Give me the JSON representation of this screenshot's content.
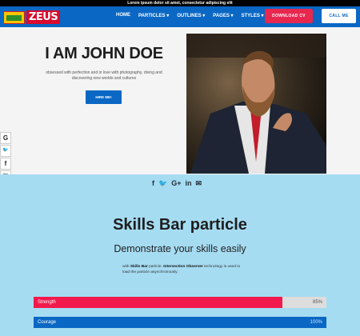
{
  "topbar": {
    "text": "Lorem ipsum dolor sit amet, consectetur adipiscing elit"
  },
  "nav": {
    "logo_text": "ZEUS",
    "menu": [
      "HOME",
      "PARTICLES ▾",
      "OUTLINES ▾",
      "PAGES ▾",
      "STYLES ▾"
    ],
    "download_label": "DOWNLOAD CV",
    "call_label": "CALL ME"
  },
  "hero": {
    "title": "I AM JOHN DOE",
    "subtitle": "obsessed with perfection and in love with photography, diving and discovering new worlds and cultures",
    "hire_label": "HIRE ME!"
  },
  "social_rail": [
    "G",
    "🐦",
    "f",
    "You Tube",
    "◎",
    "✉"
  ],
  "skills": {
    "title": "Skills Bar particle",
    "subtitle": "Demonstrate your skills easily",
    "desc_pre": "with ",
    "desc_b1": "Skills Bar",
    "desc_mid": " particle. ",
    "desc_b2": "Intersection Observer",
    "desc_post": " technology is used to load the particle asynchronously.",
    "bars": [
      {
        "label": "Strength",
        "percent_label": "85%",
        "value": 85,
        "color": "#f2194d"
      },
      {
        "label": "Courage",
        "percent_label": "100%",
        "value": 100,
        "color": "#0a67c4"
      }
    ]
  },
  "colors": {
    "brand_blue": "#0a67c4",
    "accent_red": "#e8274f",
    "skills_bg": "#a6dcf2"
  }
}
